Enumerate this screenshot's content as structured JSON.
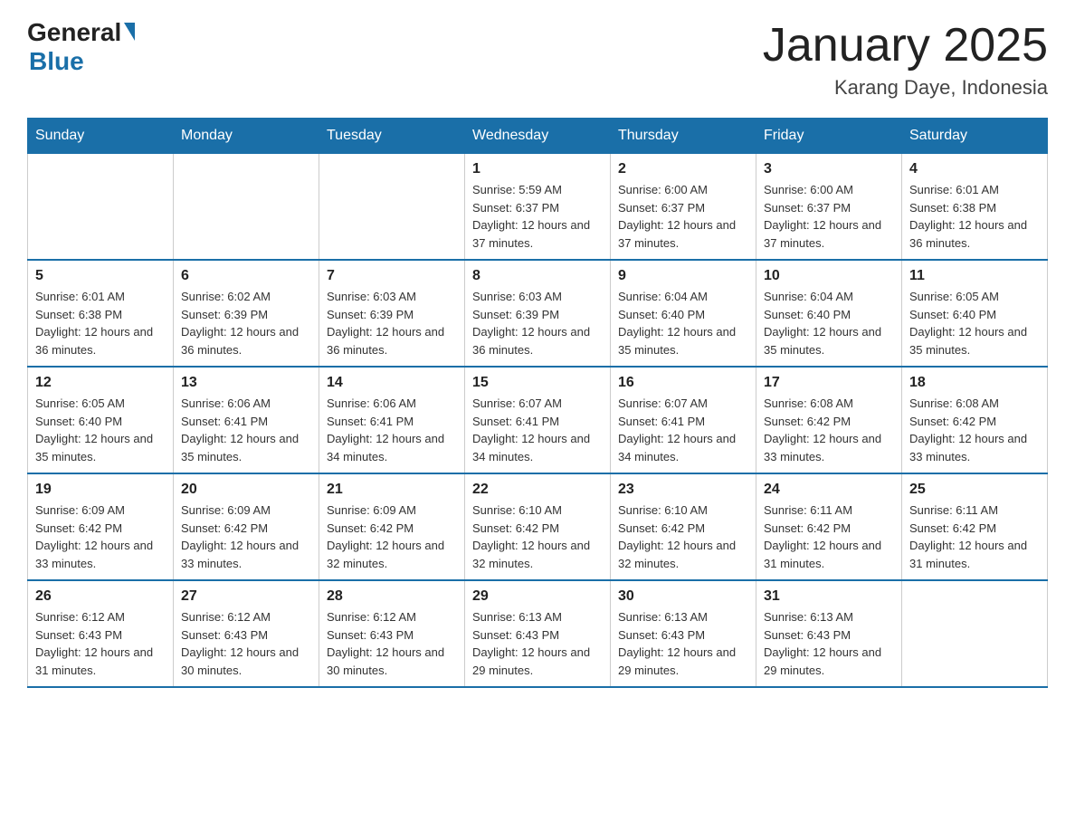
{
  "header": {
    "logo_general": "General",
    "logo_blue": "Blue",
    "month_title": "January 2025",
    "location": "Karang Daye, Indonesia"
  },
  "days_of_week": [
    "Sunday",
    "Monday",
    "Tuesday",
    "Wednesday",
    "Thursday",
    "Friday",
    "Saturday"
  ],
  "weeks": [
    [
      {
        "day": "",
        "info": ""
      },
      {
        "day": "",
        "info": ""
      },
      {
        "day": "",
        "info": ""
      },
      {
        "day": "1",
        "info": "Sunrise: 5:59 AM\nSunset: 6:37 PM\nDaylight: 12 hours\nand 37 minutes."
      },
      {
        "day": "2",
        "info": "Sunrise: 6:00 AM\nSunset: 6:37 PM\nDaylight: 12 hours\nand 37 minutes."
      },
      {
        "day": "3",
        "info": "Sunrise: 6:00 AM\nSunset: 6:37 PM\nDaylight: 12 hours\nand 37 minutes."
      },
      {
        "day": "4",
        "info": "Sunrise: 6:01 AM\nSunset: 6:38 PM\nDaylight: 12 hours\nand 36 minutes."
      }
    ],
    [
      {
        "day": "5",
        "info": "Sunrise: 6:01 AM\nSunset: 6:38 PM\nDaylight: 12 hours\nand 36 minutes."
      },
      {
        "day": "6",
        "info": "Sunrise: 6:02 AM\nSunset: 6:39 PM\nDaylight: 12 hours\nand 36 minutes."
      },
      {
        "day": "7",
        "info": "Sunrise: 6:03 AM\nSunset: 6:39 PM\nDaylight: 12 hours\nand 36 minutes."
      },
      {
        "day": "8",
        "info": "Sunrise: 6:03 AM\nSunset: 6:39 PM\nDaylight: 12 hours\nand 36 minutes."
      },
      {
        "day": "9",
        "info": "Sunrise: 6:04 AM\nSunset: 6:40 PM\nDaylight: 12 hours\nand 35 minutes."
      },
      {
        "day": "10",
        "info": "Sunrise: 6:04 AM\nSunset: 6:40 PM\nDaylight: 12 hours\nand 35 minutes."
      },
      {
        "day": "11",
        "info": "Sunrise: 6:05 AM\nSunset: 6:40 PM\nDaylight: 12 hours\nand 35 minutes."
      }
    ],
    [
      {
        "day": "12",
        "info": "Sunrise: 6:05 AM\nSunset: 6:40 PM\nDaylight: 12 hours\nand 35 minutes."
      },
      {
        "day": "13",
        "info": "Sunrise: 6:06 AM\nSunset: 6:41 PM\nDaylight: 12 hours\nand 35 minutes."
      },
      {
        "day": "14",
        "info": "Sunrise: 6:06 AM\nSunset: 6:41 PM\nDaylight: 12 hours\nand 34 minutes."
      },
      {
        "day": "15",
        "info": "Sunrise: 6:07 AM\nSunset: 6:41 PM\nDaylight: 12 hours\nand 34 minutes."
      },
      {
        "day": "16",
        "info": "Sunrise: 6:07 AM\nSunset: 6:41 PM\nDaylight: 12 hours\nand 34 minutes."
      },
      {
        "day": "17",
        "info": "Sunrise: 6:08 AM\nSunset: 6:42 PM\nDaylight: 12 hours\nand 33 minutes."
      },
      {
        "day": "18",
        "info": "Sunrise: 6:08 AM\nSunset: 6:42 PM\nDaylight: 12 hours\nand 33 minutes."
      }
    ],
    [
      {
        "day": "19",
        "info": "Sunrise: 6:09 AM\nSunset: 6:42 PM\nDaylight: 12 hours\nand 33 minutes."
      },
      {
        "day": "20",
        "info": "Sunrise: 6:09 AM\nSunset: 6:42 PM\nDaylight: 12 hours\nand 33 minutes."
      },
      {
        "day": "21",
        "info": "Sunrise: 6:09 AM\nSunset: 6:42 PM\nDaylight: 12 hours\nand 32 minutes."
      },
      {
        "day": "22",
        "info": "Sunrise: 6:10 AM\nSunset: 6:42 PM\nDaylight: 12 hours\nand 32 minutes."
      },
      {
        "day": "23",
        "info": "Sunrise: 6:10 AM\nSunset: 6:42 PM\nDaylight: 12 hours\nand 32 minutes."
      },
      {
        "day": "24",
        "info": "Sunrise: 6:11 AM\nSunset: 6:42 PM\nDaylight: 12 hours\nand 31 minutes."
      },
      {
        "day": "25",
        "info": "Sunrise: 6:11 AM\nSunset: 6:42 PM\nDaylight: 12 hours\nand 31 minutes."
      }
    ],
    [
      {
        "day": "26",
        "info": "Sunrise: 6:12 AM\nSunset: 6:43 PM\nDaylight: 12 hours\nand 31 minutes."
      },
      {
        "day": "27",
        "info": "Sunrise: 6:12 AM\nSunset: 6:43 PM\nDaylight: 12 hours\nand 30 minutes."
      },
      {
        "day": "28",
        "info": "Sunrise: 6:12 AM\nSunset: 6:43 PM\nDaylight: 12 hours\nand 30 minutes."
      },
      {
        "day": "29",
        "info": "Sunrise: 6:13 AM\nSunset: 6:43 PM\nDaylight: 12 hours\nand 29 minutes."
      },
      {
        "day": "30",
        "info": "Sunrise: 6:13 AM\nSunset: 6:43 PM\nDaylight: 12 hours\nand 29 minutes."
      },
      {
        "day": "31",
        "info": "Sunrise: 6:13 AM\nSunset: 6:43 PM\nDaylight: 12 hours\nand 29 minutes."
      },
      {
        "day": "",
        "info": ""
      }
    ]
  ]
}
